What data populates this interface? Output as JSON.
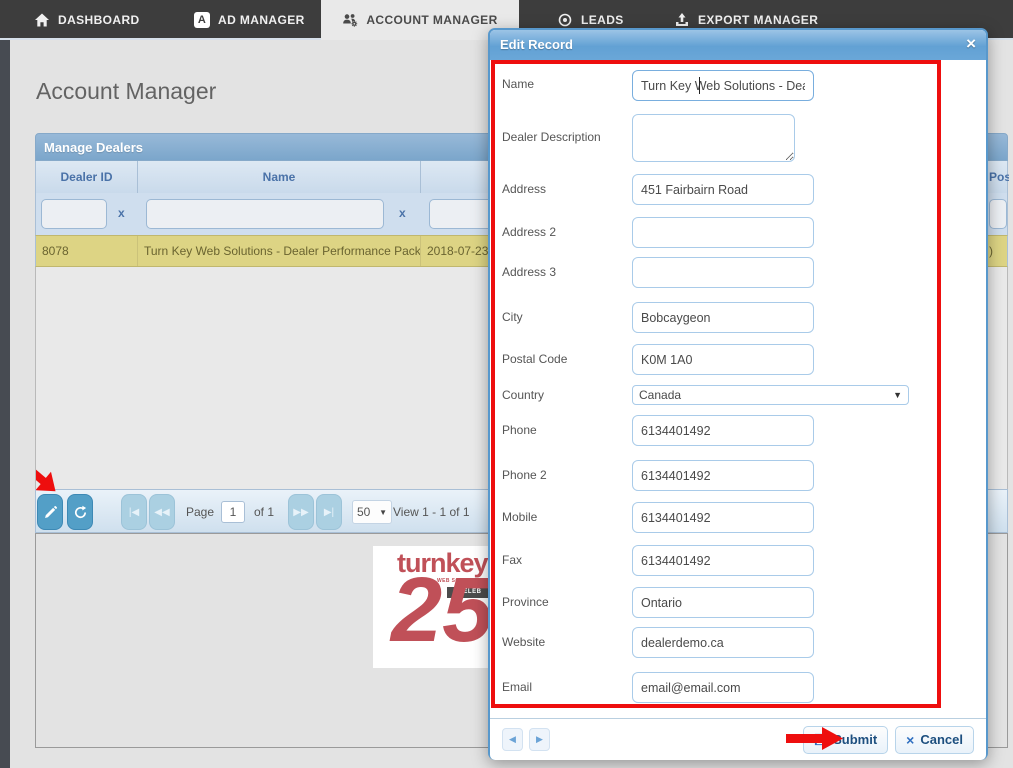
{
  "nav": {
    "tabs": [
      {
        "label": "DASHBOARD",
        "icon": "home-icon",
        "active": false
      },
      {
        "label": "AD MANAGER",
        "icon": "ad-icon",
        "active": false
      },
      {
        "label": "ACCOUNT MANAGER",
        "icon": "users-gear-icon",
        "active": true
      },
      {
        "label": "LEADS",
        "icon": "leads-icon",
        "active": false
      },
      {
        "label": "EXPORT MANAGER",
        "icon": "export-icon",
        "active": false
      }
    ]
  },
  "page": {
    "title": "Account Manager"
  },
  "grid": {
    "caption": "Manage Dealers",
    "columns": [
      {
        "label": "Dealer ID"
      },
      {
        "label": "Name"
      },
      {
        "label": ""
      },
      {
        "label": "Post"
      }
    ],
    "filter_clear": "x",
    "row": {
      "dealer_id": "8078",
      "name": "Turn Key Web Solutions - Dealer Performance Packag",
      "date": "2018-07-23",
      "right_fragment": ")"
    },
    "pager": {
      "page_label": "Page",
      "page_value": "1",
      "of_label": "of 1",
      "page_size": "50",
      "view_text": "View 1 - 1 of 1"
    }
  },
  "logo": {
    "brand": "turnkey",
    "tagline": "WEB SOLUTIONS",
    "banner": "CELEB",
    "number": "25"
  },
  "modal": {
    "title": "Edit Record",
    "close_label": "×",
    "fields": [
      {
        "label": "Name",
        "value": "Turn Key Web Solutions - Dealer",
        "type": "text"
      },
      {
        "label": "Dealer Description",
        "value": "",
        "type": "textarea"
      },
      {
        "label": "Address",
        "value": "451 Fairbairn Road",
        "type": "text"
      },
      {
        "label": "Address 2",
        "value": "",
        "type": "text"
      },
      {
        "label": "Address 3",
        "value": "",
        "type": "text"
      },
      {
        "label": "City",
        "value": "Bobcaygeon",
        "type": "text"
      },
      {
        "label": "Postal Code",
        "value": "K0M 1A0",
        "type": "text"
      },
      {
        "label": "Country",
        "value": "Canada",
        "type": "select"
      },
      {
        "label": "Phone",
        "value": "6134401492",
        "type": "text"
      },
      {
        "label": "Phone 2",
        "value": "6134401492",
        "type": "text"
      },
      {
        "label": "Mobile",
        "value": "6134401492",
        "type": "text"
      },
      {
        "label": "Fax",
        "value": "6134401492",
        "type": "text"
      },
      {
        "label": "Province",
        "value": "Ontario",
        "type": "text"
      },
      {
        "label": "Website",
        "value": "dealerdemo.ca",
        "type": "text"
      },
      {
        "label": "Email",
        "value": "email@email.com",
        "type": "text"
      }
    ],
    "footer": {
      "submit_label": "Submit",
      "cancel_label": "Cancel"
    }
  },
  "colors": {
    "nav_dark": "#3d3d3d",
    "header_blue": "#62a1d4",
    "row_highlight": "#ddd484",
    "annotation_red": "#ee0e0e",
    "pager_button_blue": "#539fc7",
    "logo_red": "#c05058"
  }
}
